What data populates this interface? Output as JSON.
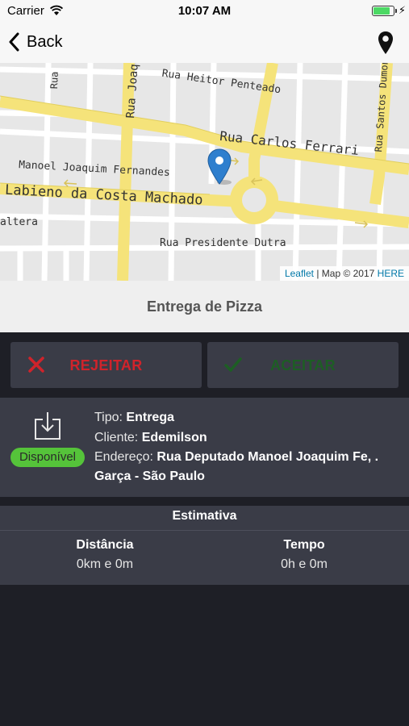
{
  "status_bar": {
    "carrier": "Carrier",
    "time": "10:07 AM",
    "battery_level": 0.85
  },
  "nav": {
    "back_label": "Back",
    "location_icon": "location-pin-icon"
  },
  "map": {
    "roads": {
      "heitor_penteado": "Rua Heitor Penteado",
      "carlos_ferrari": "Rua Carlos Ferrari",
      "manoel_joaquim": "Manoel Joaquim Fernandes",
      "labieno": "Labieno da Costa Machado",
      "presidente_dutra": "Rua Presidente Dutra",
      "altera": "altera",
      "joaquim": "Rua Joaqui",
      "santos_dumont": "Rua Santos Dumont",
      "rua_left": "Rua"
    },
    "attribution": {
      "leaflet": "Leaflet",
      "text": " | Map © 2017 ",
      "here": "HERE"
    }
  },
  "title": "Entrega de Pizza",
  "actions": {
    "reject_label": "REJEITAR",
    "accept_label": "ACEITAR"
  },
  "details": {
    "status_badge": "Disponível",
    "tipo_label": "Tipo: ",
    "tipo_value": "Entrega",
    "cliente_label": "Cliente: ",
    "cliente_value": "Edemilson",
    "endereco_label": "Endereço: ",
    "endereco_value": "Rua Deputado Manoel Joaquim Fe, .",
    "cidade_value": "Garça - São Paulo"
  },
  "estimate": {
    "header": "Estimativa",
    "distance_label": "Distância",
    "distance_value": "0km e 0m",
    "time_label": "Tempo",
    "time_value": "0h e 0m"
  },
  "colors": {
    "reject": "#d0232b",
    "accept": "#1d5e24",
    "badge": "#55c33a",
    "road": "#f5e37a"
  }
}
